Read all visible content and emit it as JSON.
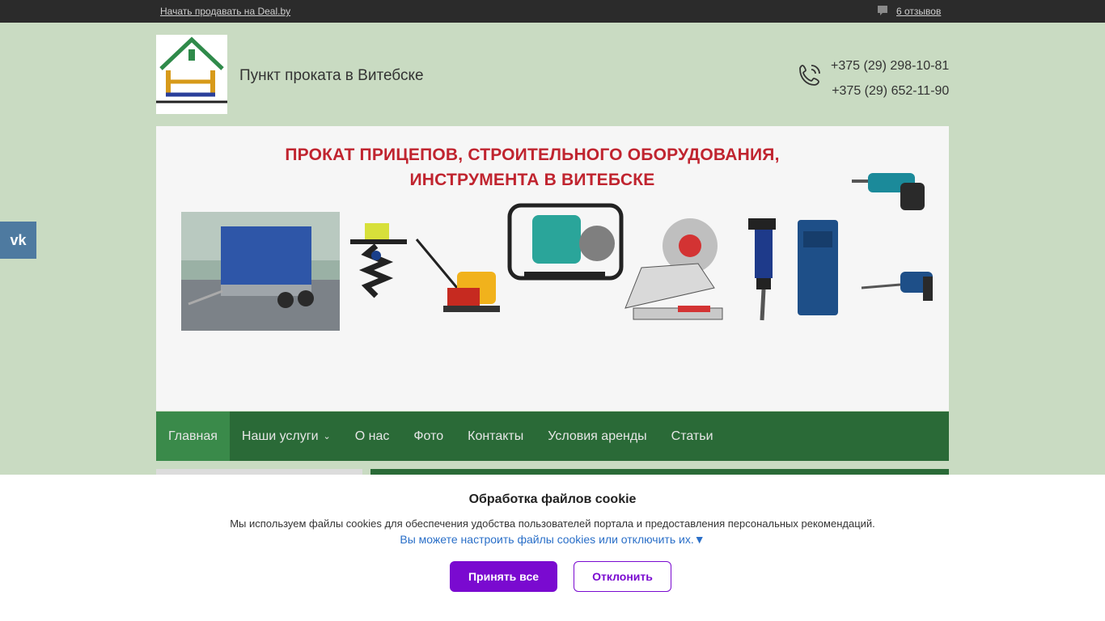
{
  "topbar": {
    "sell_link": "Начать продавать на Deal.by",
    "reviews_link": "6 отзывов",
    "reviews_icon": "speech-bubble-icon"
  },
  "header": {
    "site_title": "Пункт проката в Витебске",
    "phone_icon": "phone-icon",
    "phones": [
      "+375 (29) 298-10-81",
      "+375 (29) 652-11-90"
    ]
  },
  "banner": {
    "headline_line1": "ПРОКАТ ПРИЦЕПОВ, СТРОИТЕЛЬНОГО ОБОРУДОВАНИЯ,",
    "headline_line2": "ИНСТРУМЕНТА В ВИТЕБСКЕ"
  },
  "nav": {
    "items": [
      {
        "label": "Главная",
        "active": true
      },
      {
        "label": "Наши услуги",
        "has_dropdown": true
      },
      {
        "label": "О нас"
      },
      {
        "label": "Фото"
      },
      {
        "label": "Контакты"
      },
      {
        "label": "Условия аренды"
      },
      {
        "label": "Статьи"
      }
    ]
  },
  "social": {
    "vk_label": "vk",
    "vk_icon": "vk-icon"
  },
  "cookie": {
    "title": "Обработка файлов cookie",
    "description": "Мы используем файлы cookies для обеспечения удобства пользователей портала и предоставления персональных рекомендаций.",
    "settings_link": "Вы можете настроить файлы cookies или отключить их.▼",
    "accept_label": "Принять все",
    "decline_label": "Отклонить"
  },
  "colors": {
    "page_bg": "#c9dbc2",
    "topbar_bg": "#2b2b2b",
    "nav_bg": "#2a6a37",
    "nav_active_bg": "#3a8a4a",
    "headline_red": "#c0242f",
    "accent_purple": "#7a0ad0",
    "link_blue": "#2a6fc8",
    "vk_blue": "#4e7aa0"
  }
}
